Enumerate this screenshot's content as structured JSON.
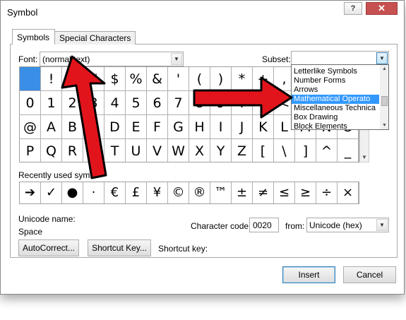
{
  "window": {
    "title": "Symbol",
    "help_label": "?",
    "close_label": "✕"
  },
  "tabs": [
    {
      "label": "Symbols"
    },
    {
      "label": "Special Characters"
    }
  ],
  "font": {
    "label": "Font:",
    "value": "(normal text)"
  },
  "subset": {
    "label": "Subset:",
    "value": "",
    "options": [
      "Letterlike Symbols",
      "Number Forms",
      "Arrows",
      "Mathematical Operato",
      "Miscellaneous Technica",
      "Box Drawing",
      "Block Elements"
    ],
    "highlighted": "Mathematical Operato"
  },
  "symbols": {
    "row1": [
      " ",
      "!",
      "\"",
      "#",
      "$",
      "%",
      "&",
      "'",
      "(",
      ")",
      "*",
      "+",
      ",",
      "-",
      ".",
      "/"
    ],
    "row2": [
      "0",
      "1",
      "2",
      "3",
      "4",
      "5",
      "6",
      "7",
      "8",
      "9",
      ":",
      ";",
      "<",
      "=",
      ">",
      "?"
    ],
    "row3": [
      "@",
      "A",
      "B",
      "C",
      "D",
      "E",
      "F",
      "G",
      "H",
      "I",
      "J",
      "K",
      "L",
      "M",
      "N",
      "O"
    ],
    "row4": [
      "P",
      "Q",
      "R",
      "S",
      "T",
      "U",
      "V",
      "W",
      "X",
      "Y",
      "Z",
      "[",
      "\\",
      "]",
      "^",
      "_"
    ]
  },
  "recent": {
    "label": "Recently used symb",
    "symbols": [
      "➔",
      "✓",
      "●",
      "·",
      "€",
      "£",
      "¥",
      "©",
      "®",
      "™",
      "±",
      "≠",
      "≤",
      "≥",
      "÷",
      "×"
    ]
  },
  "unicode": {
    "name_label": "Unicode name:",
    "name_value": "Space"
  },
  "char_code": {
    "label": "Character code:",
    "value": "0020",
    "from_label": "from:",
    "from_value": "Unicode (hex)"
  },
  "buttons": {
    "autocorrect": "AutoCorrect...",
    "shortcut_key": "Shortcut Key...",
    "shortcut_label": "Shortcut key:",
    "insert": "Insert",
    "cancel": "Cancel"
  },
  "colors": {
    "selection": "#3b8ee5",
    "highlight": "#3399ff",
    "arrow_fill": "#e2141b",
    "close": "#c75050"
  }
}
